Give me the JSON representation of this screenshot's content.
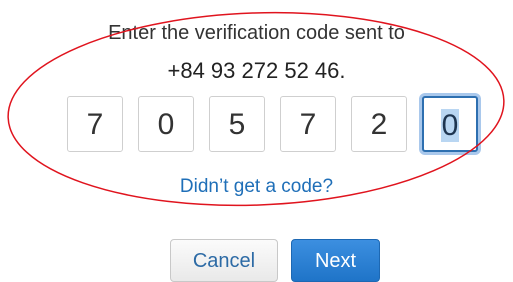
{
  "verification": {
    "prompt": "Enter the verification code sent to",
    "phone": "+84 93 272 52 46.",
    "digits": [
      "7",
      "0",
      "5",
      "7",
      "2",
      "0"
    ],
    "resend_link": "Didn’t get a code?"
  },
  "actions": {
    "cancel_label": "Cancel",
    "next_label": "Next"
  },
  "colors": {
    "link": "#1f6fb8",
    "primary_button": "#2a80d6",
    "focus_ring": "#a9c8ec",
    "annotation": "#e0141e"
  }
}
